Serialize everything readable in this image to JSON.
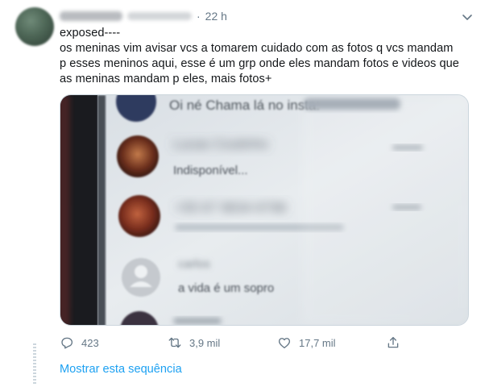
{
  "tweet": {
    "time": "22 h",
    "separator": "·",
    "text_lines": [
      "exposed----",
      "os meninas vim avisar vcs a tomarem cuidado com as fotos q vcs mandam",
      "p esses meninos aqui, esse é um grp onde eles mandam fotos e videos que",
      "as meninas mandam p eles, mais fotos+"
    ],
    "photo": {
      "rows": [
        {
          "name": "",
          "message": "Oi né  Chama lá no insta:"
        },
        {
          "name": "Lucas Coutinho",
          "message": "Indisponível..."
        },
        {
          "name": "+55 67 9634-9798",
          "message": ""
        },
        {
          "name": "carlos",
          "message": "a vida é um sopro"
        }
      ]
    },
    "actions": {
      "reply_count": "423",
      "retweet_count": "3,9 mil",
      "like_count": "17,7 mil"
    },
    "show_thread": "Mostrar esta sequência"
  },
  "colors": {
    "text": "#14171a",
    "secondary": "#657786",
    "link": "#1da1f2"
  },
  "icons": [
    "more-caret-icon",
    "reply-icon",
    "retweet-icon",
    "like-icon",
    "share-icon"
  ]
}
